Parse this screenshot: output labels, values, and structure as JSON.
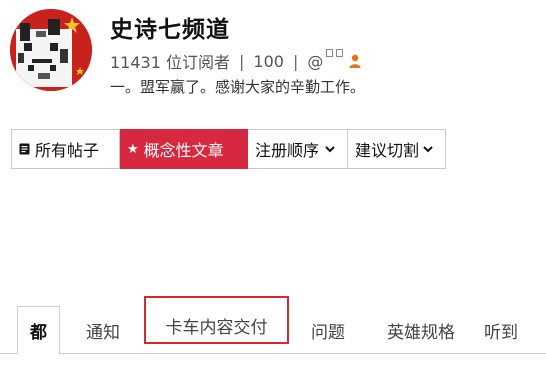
{
  "channel": {
    "name": "史诗七频道",
    "subscribers": "11431 位订阅者",
    "posts": "100",
    "handle_prefix": "@",
    "tagline": "一。盟军赢了。感谢大家的辛勤工作。"
  },
  "filters": [
    {
      "label": "所有帖子",
      "icon": "document-icon"
    },
    {
      "label": "概念性文章",
      "icon": "star-icon"
    },
    {
      "label": "注册顺序",
      "icon": "chevron-down-icon"
    },
    {
      "label": "建议切割",
      "icon": "chevron-down-icon"
    }
  ],
  "tabs": [
    {
      "label": "都"
    },
    {
      "label": "通知"
    },
    {
      "label": "卡车内容交付"
    },
    {
      "label": "问题"
    },
    {
      "label": "英雄规格"
    },
    {
      "label": "听到"
    }
  ],
  "colors": {
    "accent": "#d6283e",
    "highlight_box": "#d42a2a",
    "user_icon": "#e8711c"
  }
}
